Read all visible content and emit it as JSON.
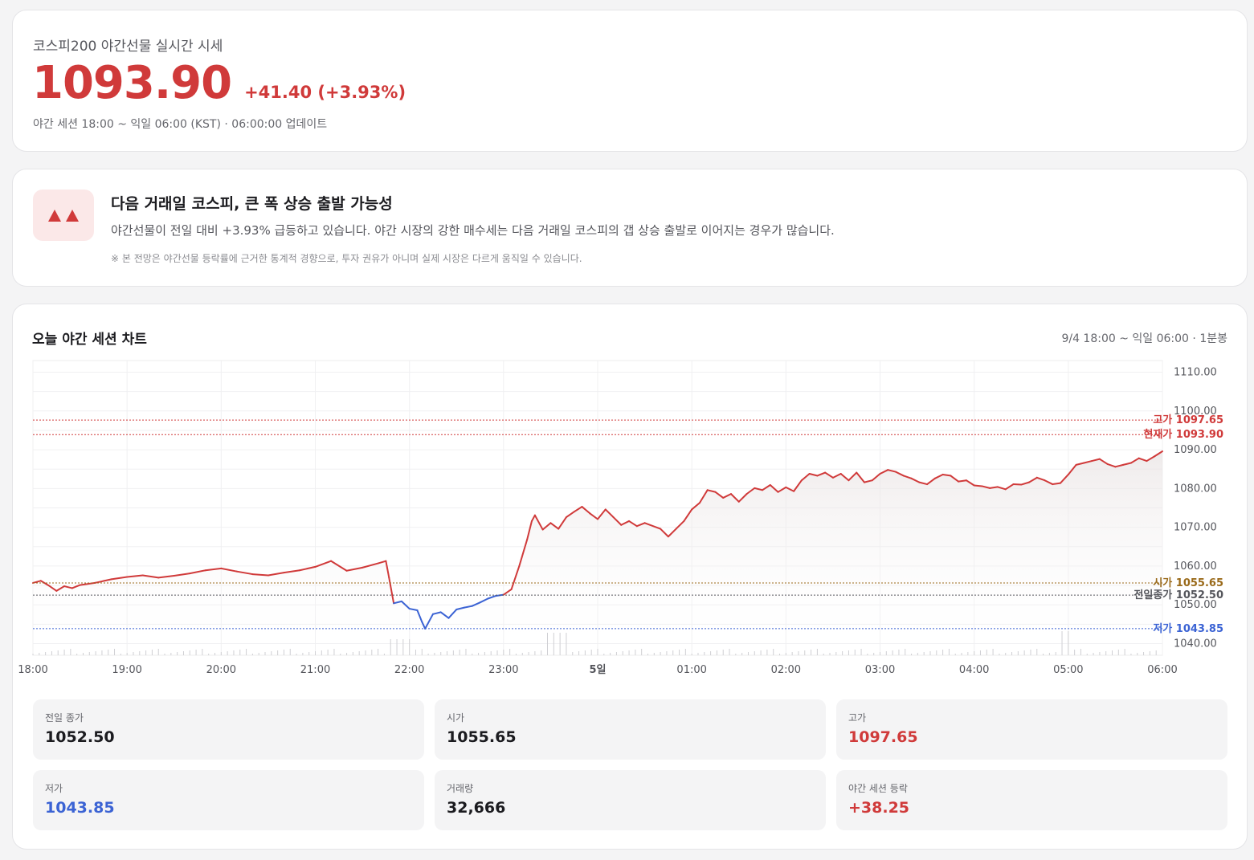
{
  "header": {
    "title": "코스피200 야간선물 실시간 시세",
    "price": "1093.90",
    "change": "+41.40 (+3.93%)",
    "meta": "야간 세션 18:00 ~ 익일 06:00 (KST) · 06:00:00 업데이트"
  },
  "outlook": {
    "icon": "double-up-triangle-icon",
    "title": "다음 거래일 코스피, 큰 폭 상승 출발 가능성",
    "description": "야간선물이 전일 대비 +3.93% 급등하고 있습니다. 야간 시장의 강한 매수세는 다음 거래일 코스피의 갭 상승 출발로 이어지는 경우가 많습니다.",
    "note": "※ 본 전망은 야간선물 등락률에 근거한 통계적 경향으로, 투자 권유가 아니며 실제 시장은 다르게 움직일 수 있습니다."
  },
  "chart_section": {
    "title": "오늘 야간 세션 차트",
    "range": "9/4 18:00 ~ 익일 06:00 · 1분봉"
  },
  "colors": {
    "up": "#d03a3a",
    "down": "#3b63d4",
    "open": "#9a6a1a",
    "prev_close": "#55565c"
  },
  "chart_data": {
    "type": "line",
    "x_axis": {
      "ticks": [
        "18:00",
        "19:00",
        "20:00",
        "21:00",
        "22:00",
        "23:00",
        "5일",
        "01:00",
        "02:00",
        "03:00",
        "04:00",
        "05:00",
        "06:00"
      ],
      "range": [
        "18:00",
        "06:00"
      ]
    },
    "y_axis": {
      "ticks": [
        "1110.00",
        "1100.00",
        "1090.00",
        "1080.00",
        "1070.00",
        "1060.00",
        "1050.00",
        "1040.00"
      ],
      "ylim": [
        1037,
        1113
      ],
      "position": "right"
    },
    "grid": true,
    "baseline": 1052.5,
    "reference_lines": [
      {
        "label": "고가",
        "value": 1097.65,
        "value_text": "1097.65",
        "color": "#d03a3a"
      },
      {
        "label": "현재가",
        "value": 1093.9,
        "value_text": "1093.90",
        "color": "#d03a3a"
      },
      {
        "label": "시가",
        "value": 1055.65,
        "value_text": "1055.65",
        "color": "#9a6a1a"
      },
      {
        "label": "전일종가",
        "value": 1052.5,
        "value_text": "1052.50",
        "color": "#55565c"
      },
      {
        "label": "저가",
        "value": 1043.85,
        "value_text": "1043.85",
        "color": "#3b63d4"
      }
    ],
    "series": [
      {
        "points": [
          [
            "18:00",
            1055.65
          ],
          [
            "18:05",
            1056.2
          ],
          [
            "18:10",
            1055.0
          ],
          [
            "18:15",
            1053.6
          ],
          [
            "18:20",
            1054.8
          ],
          [
            "18:25",
            1054.3
          ],
          [
            "18:30",
            1055.1
          ],
          [
            "18:40",
            1055.7
          ],
          [
            "18:50",
            1056.6
          ],
          [
            "19:00",
            1057.2
          ],
          [
            "19:10",
            1057.6
          ],
          [
            "19:20",
            1057.0
          ],
          [
            "19:30",
            1057.5
          ],
          [
            "19:40",
            1058.1
          ],
          [
            "19:50",
            1058.9
          ],
          [
            "20:00",
            1059.4
          ],
          [
            "20:10",
            1058.6
          ],
          [
            "20:20",
            1057.9
          ],
          [
            "20:30",
            1057.6
          ],
          [
            "20:40",
            1058.3
          ],
          [
            "20:50",
            1058.9
          ],
          [
            "21:00",
            1059.8
          ],
          [
            "21:10",
            1061.3
          ],
          [
            "21:20",
            1058.8
          ],
          [
            "21:30",
            1059.6
          ],
          [
            "21:40",
            1060.7
          ],
          [
            "21:45",
            1061.3
          ],
          [
            "21:47",
            1057.0
          ],
          [
            "21:50",
            1050.4
          ],
          [
            "21:55",
            1050.9
          ],
          [
            "22:00",
            1049.0
          ],
          [
            "22:05",
            1048.6
          ],
          [
            "22:08",
            1045.6
          ],
          [
            "22:10",
            1043.85
          ],
          [
            "22:15",
            1047.6
          ],
          [
            "22:20",
            1048.1
          ],
          [
            "22:25",
            1046.6
          ],
          [
            "22:30",
            1048.8
          ],
          [
            "22:35",
            1049.3
          ],
          [
            "22:40",
            1049.7
          ],
          [
            "22:45",
            1050.6
          ],
          [
            "22:50",
            1051.6
          ],
          [
            "22:55",
            1052.3
          ],
          [
            "23:00",
            1052.6
          ],
          [
            "23:05",
            1054.0
          ],
          [
            "23:10",
            1060.0
          ],
          [
            "23:15",
            1066.8
          ],
          [
            "23:18",
            1071.6
          ],
          [
            "23:20",
            1073.1
          ],
          [
            "23:25",
            1069.4
          ],
          [
            "23:30",
            1071.1
          ],
          [
            "23:35",
            1069.6
          ],
          [
            "23:40",
            1072.6
          ],
          [
            "23:45",
            1074.0
          ],
          [
            "23:50",
            1075.3
          ],
          [
            "23:55",
            1073.6
          ],
          [
            "00:00",
            1072.1
          ],
          [
            "00:05",
            1074.6
          ],
          [
            "00:10",
            1072.6
          ],
          [
            "00:15",
            1070.6
          ],
          [
            "00:20",
            1071.6
          ],
          [
            "00:25",
            1070.3
          ],
          [
            "00:30",
            1071.1
          ],
          [
            "00:40",
            1069.6
          ],
          [
            "00:45",
            1067.6
          ],
          [
            "00:50",
            1069.6
          ],
          [
            "00:55",
            1071.6
          ],
          [
            "01:00",
            1074.6
          ],
          [
            "01:05",
            1076.3
          ],
          [
            "01:10",
            1079.6
          ],
          [
            "01:15",
            1079.1
          ],
          [
            "01:20",
            1077.6
          ],
          [
            "01:25",
            1078.6
          ],
          [
            "01:30",
            1076.6
          ],
          [
            "01:35",
            1078.6
          ],
          [
            "01:40",
            1080.1
          ],
          [
            "01:45",
            1079.6
          ],
          [
            "01:50",
            1080.9
          ],
          [
            "01:55",
            1079.1
          ],
          [
            "02:00",
            1080.3
          ],
          [
            "02:05",
            1079.3
          ],
          [
            "02:10",
            1082.1
          ],
          [
            "02:15",
            1083.8
          ],
          [
            "02:20",
            1083.3
          ],
          [
            "02:25",
            1084.1
          ],
          [
            "02:30",
            1082.8
          ],
          [
            "02:35",
            1083.8
          ],
          [
            "02:40",
            1082.1
          ],
          [
            "02:45",
            1084.1
          ],
          [
            "02:50",
            1081.6
          ],
          [
            "02:55",
            1082.1
          ],
          [
            "03:00",
            1083.8
          ],
          [
            "03:05",
            1084.8
          ],
          [
            "03:10",
            1084.3
          ],
          [
            "03:15",
            1083.3
          ],
          [
            "03:20",
            1082.6
          ],
          [
            "03:25",
            1081.6
          ],
          [
            "03:30",
            1081.1
          ],
          [
            "03:35",
            1082.6
          ],
          [
            "03:40",
            1083.6
          ],
          [
            "03:45",
            1083.3
          ],
          [
            "03:50",
            1081.8
          ],
          [
            "03:55",
            1082.1
          ],
          [
            "04:00",
            1080.8
          ],
          [
            "04:05",
            1080.6
          ],
          [
            "04:10",
            1080.1
          ],
          [
            "04:15",
            1080.4
          ],
          [
            "04:20",
            1079.8
          ],
          [
            "04:25",
            1081.1
          ],
          [
            "04:30",
            1081.0
          ],
          [
            "04:35",
            1081.6
          ],
          [
            "04:40",
            1082.8
          ],
          [
            "04:45",
            1082.1
          ],
          [
            "04:50",
            1081.1
          ],
          [
            "04:55",
            1081.4
          ],
          [
            "05:00",
            1083.6
          ],
          [
            "05:05",
            1086.1
          ],
          [
            "05:10",
            1086.6
          ],
          [
            "05:15",
            1087.1
          ],
          [
            "05:20",
            1087.6
          ],
          [
            "05:25",
            1086.3
          ],
          [
            "05:30",
            1085.6
          ],
          [
            "05:35",
            1086.1
          ],
          [
            "05:40",
            1086.6
          ],
          [
            "05:45",
            1087.8
          ],
          [
            "05:50",
            1087.1
          ],
          [
            "05:55",
            1088.3
          ],
          [
            "06:00",
            1089.6
          ]
        ]
      }
    ]
  },
  "stats": [
    {
      "label": "전일 종가",
      "value": "1052.50",
      "tone": "neutral"
    },
    {
      "label": "시가",
      "value": "1055.65",
      "tone": "neutral"
    },
    {
      "label": "고가",
      "value": "1097.65",
      "tone": "up"
    },
    {
      "label": "저가",
      "value": "1043.85",
      "tone": "down"
    },
    {
      "label": "거래량",
      "value": "32,666",
      "tone": "neutral"
    },
    {
      "label": "야간 세션 등락",
      "value": "+38.25",
      "tone": "up"
    }
  ]
}
